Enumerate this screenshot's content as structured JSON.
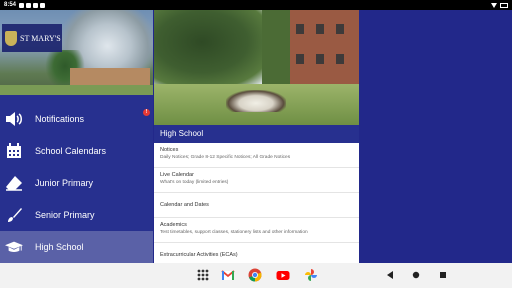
{
  "status_bar": {
    "time": "8:54"
  },
  "drawer": {
    "logo_text": "ST MARY'S",
    "items": [
      {
        "label": "Notifications",
        "icon": "speaker-icon",
        "badge": "!"
      },
      {
        "label": "School Calendars",
        "icon": "calendar-icon"
      },
      {
        "label": "Junior Primary",
        "icon": "eraser-icon"
      },
      {
        "label": "Senior Primary",
        "icon": "paintbrush-icon"
      },
      {
        "label": "High School",
        "icon": "graduation-cap-icon",
        "active": true
      }
    ]
  },
  "content": {
    "section_title": "High School",
    "items": [
      {
        "title": "Notices",
        "subtitle": "Daily Notices; Grade 8-12 Specific Notices; All Grade Notices"
      },
      {
        "title": "Live Calendar",
        "subtitle": "What's on today (limited entries)"
      },
      {
        "title": "Calendar and Dates",
        "subtitle": ""
      },
      {
        "title": "Academics",
        "subtitle": "Test timetables, support classes, stationery lists and other information"
      },
      {
        "title": "Extracurricular Activities (ECAs)",
        "subtitle": ""
      }
    ]
  },
  "nav_bar": {
    "apps": [
      "apps-grid-icon",
      "gmail-icon",
      "chrome-icon",
      "youtube-icon",
      "photos-icon"
    ],
    "buttons": [
      "back-icon",
      "home-icon",
      "recents-icon"
    ]
  },
  "colors": {
    "primary": "#27308f",
    "background": "#22288a",
    "active_item": "#5a61a7",
    "badge": "#e53935"
  }
}
